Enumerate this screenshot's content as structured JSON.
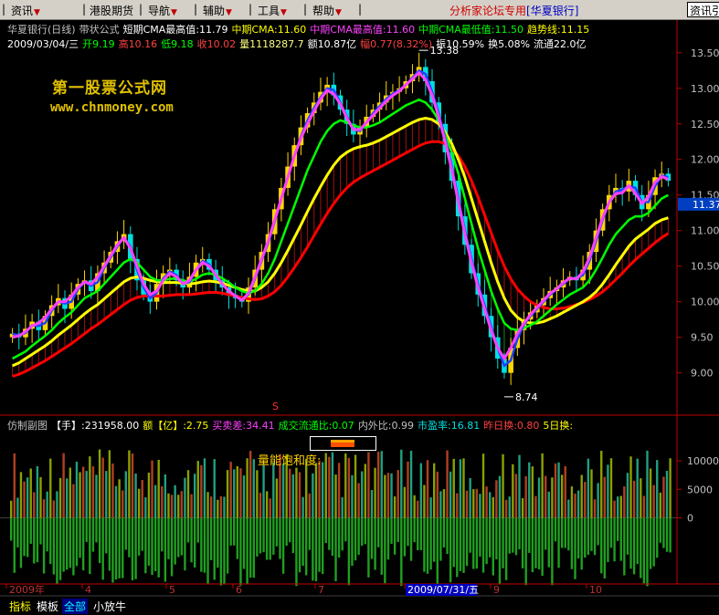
{
  "menu": {
    "items": [
      "资讯",
      "港股期货",
      "导航",
      "辅助",
      "工具",
      "帮助"
    ],
    "forum_text": "分析家论坛专用",
    "stock_tag": "[华夏银行]",
    "search_text": "资讯引"
  },
  "header": {
    "row1": [
      {
        "text": "华夏银行(日线)",
        "color": "#c0c0c0"
      },
      {
        "text": "带状公式",
        "color": "#c0c0c0"
      },
      {
        "text": "短期CMA最高值:11.79",
        "color": "#ffffff"
      },
      {
        "text": "中期CMA:11.60",
        "color": "#ffff00"
      },
      {
        "text": "中期CMA最高值:11.60",
        "color": "#ff40ff"
      },
      {
        "text": "中期CMA最低值:11.50",
        "color": "#00ff00"
      },
      {
        "text": "趋势线:11.15",
        "color": "#ffff00"
      }
    ],
    "row2": [
      {
        "text": "2009/03/04/三",
        "color": "#ffffff"
      },
      {
        "text": "开9.19",
        "color": "#00ff00"
      },
      {
        "text": "高10.16",
        "color": "#ff4040"
      },
      {
        "text": "低9.18",
        "color": "#00ff00"
      },
      {
        "text": "收10.02",
        "color": "#ff4040"
      },
      {
        "text": "量1118287.7",
        "color": "#ffff80"
      },
      {
        "text": "额10.87亿",
        "color": "#ffffff"
      },
      {
        "text": "幅0.77(8.32%)",
        "color": "#ff4040"
      },
      {
        "text": "振10.59%",
        "color": "#ffffff"
      },
      {
        "text": "换5.08%",
        "color": "#ffffff"
      },
      {
        "text": "流通22.0亿",
        "color": "#ffffff"
      }
    ],
    "watermark_cn": "第一股票公式网",
    "watermark_url": "www.chnmoney.com"
  },
  "colors": {
    "up_candle": "#ffd700",
    "down_candle": "#00e0e0",
    "axis_red": "#c00000",
    "short_cma": "#ff40ff",
    "fast_line": "#2040ff",
    "mid_cma": "#00ff00",
    "trend_yellow": "#ffff00",
    "trend_red": "#ff0000"
  },
  "chart_data": {
    "type": "candlestick",
    "title": "华夏银行(日线)",
    "ylim": [
      8.7,
      13.6
    ],
    "y_ticks": [
      "13.50",
      "13.00",
      "12.50",
      "12.00",
      "11.50",
      "11.00",
      "10.50",
      "10.00",
      "9.50",
      "9.00"
    ],
    "current_price": "11.37",
    "annotations": [
      {
        "text": "13.38",
        "value": 13.38,
        "kind": "high"
      },
      {
        "text": "8.74",
        "value": 8.74,
        "kind": "low"
      }
    ],
    "x_labels": [
      "2009年",
      "4",
      "5",
      "6",
      "7",
      "2009/07/31/五",
      "9",
      "10"
    ],
    "highlight_date": "2009/07/31/五",
    "close": [
      9.55,
      9.5,
      9.62,
      9.72,
      9.6,
      9.8,
      9.95,
      10.05,
      9.9,
      10.1,
      10.25,
      10.3,
      10.15,
      10.4,
      10.55,
      10.7,
      10.85,
      10.95,
      10.6,
      10.3,
      10.1,
      10.0,
      10.25,
      10.4,
      10.45,
      10.3,
      10.2,
      10.35,
      10.55,
      10.6,
      10.45,
      10.3,
      10.2,
      10.1,
      10.05,
      10.0,
      10.2,
      10.45,
      10.7,
      10.95,
      11.3,
      11.6,
      11.9,
      12.2,
      12.45,
      12.65,
      12.8,
      12.95,
      13.05,
      12.9,
      12.7,
      12.5,
      12.35,
      12.45,
      12.6,
      12.7,
      12.8,
      12.9,
      12.95,
      13.0,
      13.1,
      13.2,
      13.3,
      13.1,
      12.8,
      12.5,
      12.1,
      11.7,
      11.2,
      10.8,
      10.4,
      10.1,
      9.8,
      9.5,
      9.2,
      9.0,
      9.35,
      9.6,
      9.75,
      9.85,
      9.95,
      10.05,
      10.15,
      10.2,
      10.3,
      10.35,
      10.3,
      10.45,
      10.7,
      11.0,
      11.3,
      11.5,
      11.6,
      11.55,
      11.7,
      11.5,
      11.3,
      11.5,
      11.75,
      11.8,
      11.7
    ],
    "short_cma": [
      9.5,
      9.52,
      9.58,
      9.66,
      9.7,
      9.78,
      9.9,
      10.0,
      10.0,
      10.08,
      10.2,
      10.28,
      10.25,
      10.35,
      10.5,
      10.65,
      10.8,
      10.9,
      10.75,
      10.5,
      10.25,
      10.1,
      10.15,
      10.3,
      10.4,
      10.35,
      10.25,
      10.3,
      10.45,
      10.55,
      10.5,
      10.38,
      10.25,
      10.15,
      10.08,
      10.02,
      10.12,
      10.35,
      10.6,
      10.85,
      11.15,
      11.45,
      11.75,
      12.05,
      12.3,
      12.5,
      12.68,
      12.85,
      12.97,
      12.92,
      12.78,
      12.58,
      12.42,
      12.42,
      12.52,
      12.62,
      12.72,
      12.82,
      12.9,
      12.96,
      13.05,
      13.13,
      13.22,
      13.12,
      12.9,
      12.6,
      12.25,
      11.85,
      11.4,
      10.95,
      10.55,
      10.2,
      9.9,
      9.6,
      9.35,
      9.2,
      9.35,
      9.55,
      9.7,
      9.82,
      9.92,
      10.02,
      10.12,
      10.18,
      10.27,
      10.33,
      10.32,
      10.42,
      10.62,
      10.9,
      11.18,
      11.4,
      11.52,
      11.53,
      11.63,
      11.52,
      11.38,
      11.48,
      11.68,
      11.76,
      11.72
    ],
    "mid_cma": [
      9.2,
      9.25,
      9.3,
      9.38,
      9.45,
      9.52,
      9.6,
      9.7,
      9.78,
      9.85,
      9.95,
      10.05,
      10.1,
      10.15,
      10.25,
      10.35,
      10.45,
      10.55,
      10.6,
      10.55,
      10.45,
      10.35,
      10.3,
      10.3,
      10.32,
      10.33,
      10.3,
      10.28,
      10.32,
      10.38,
      10.4,
      10.38,
      10.33,
      10.27,
      10.2,
      10.15,
      10.12,
      10.15,
      10.25,
      10.4,
      10.6,
      10.85,
      11.1,
      11.35,
      11.6,
      11.85,
      12.05,
      12.25,
      12.4,
      12.5,
      12.55,
      12.52,
      12.48,
      12.45,
      12.45,
      12.48,
      12.52,
      12.58,
      12.64,
      12.7,
      12.76,
      12.8,
      12.84,
      12.8,
      12.7,
      12.55,
      12.35,
      12.1,
      11.8,
      11.45,
      11.1,
      10.75,
      10.45,
      10.15,
      9.9,
      9.7,
      9.62,
      9.6,
      9.63,
      9.67,
      9.72,
      9.8,
      9.88,
      9.96,
      10.03,
      10.1,
      10.15,
      10.2,
      10.3,
      10.45,
      10.62,
      10.8,
      10.95,
      11.05,
      11.15,
      11.2,
      11.2,
      11.25,
      11.35,
      11.45,
      11.5
    ],
    "trend_yellow": [
      9.1,
      9.14,
      9.2,
      9.26,
      9.32,
      9.38,
      9.45,
      9.53,
      9.6,
      9.67,
      9.75,
      9.83,
      9.9,
      9.96,
      10.04,
      10.12,
      10.2,
      10.28,
      10.33,
      10.35,
      10.33,
      10.3,
      10.28,
      10.27,
      10.27,
      10.27,
      10.26,
      10.25,
      10.26,
      10.28,
      10.29,
      10.28,
      10.26,
      10.23,
      10.2,
      10.17,
      10.15,
      10.15,
      10.2,
      10.28,
      10.4,
      10.55,
      10.72,
      10.9,
      11.08,
      11.27,
      11.45,
      11.62,
      11.78,
      11.92,
      12.03,
      12.1,
      12.15,
      12.18,
      12.2,
      12.23,
      12.27,
      12.32,
      12.37,
      12.42,
      12.47,
      12.52,
      12.56,
      12.58,
      12.56,
      12.5,
      12.38,
      12.22,
      12.0,
      11.75,
      11.45,
      11.15,
      10.85,
      10.55,
      10.28,
      10.05,
      9.88,
      9.78,
      9.72,
      9.7,
      9.7,
      9.72,
      9.76,
      9.8,
      9.85,
      9.9,
      9.95,
      10.0,
      10.06,
      10.14,
      10.25,
      10.38,
      10.52,
      10.65,
      10.78,
      10.88,
      10.95,
      11.02,
      11.1,
      11.15,
      11.18
    ],
    "trend_red": [
      8.95,
      8.98,
      9.02,
      9.07,
      9.12,
      9.17,
      9.23,
      9.29,
      9.35,
      9.41,
      9.48,
      9.55,
      9.62,
      9.68,
      9.75,
      9.82,
      9.89,
      9.96,
      10.02,
      10.06,
      10.08,
      10.08,
      10.08,
      10.08,
      10.09,
      10.1,
      10.1,
      10.1,
      10.11,
      10.12,
      10.13,
      10.13,
      10.12,
      10.1,
      10.08,
      10.06,
      10.04,
      10.03,
      10.04,
      10.08,
      10.14,
      10.23,
      10.35,
      10.48,
      10.62,
      10.77,
      10.93,
      11.09,
      11.24,
      11.38,
      11.5,
      11.6,
      11.68,
      11.74,
      11.79,
      11.84,
      11.89,
      11.94,
      11.99,
      12.04,
      12.09,
      12.14,
      12.19,
      12.23,
      12.25,
      12.25,
      12.22,
      12.15,
      12.05,
      11.9,
      11.7,
      11.47,
      11.22,
      10.97,
      10.72,
      10.5,
      10.32,
      10.18,
      10.08,
      10.0,
      9.95,
      9.92,
      9.9,
      9.9,
      9.91,
      9.93,
      9.96,
      9.99,
      10.03,
      10.08,
      10.14,
      10.22,
      10.31,
      10.4,
      10.5,
      10.59,
      10.67,
      10.75,
      10.83,
      10.9,
      10.96
    ]
  },
  "volume_panel": {
    "items": [
      {
        "text": "仿制副图",
        "color": "#c0c0c0"
      },
      {
        "text": "【手】:231958.00",
        "color": "#ffffff"
      },
      {
        "text": "额【亿】:2.75",
        "color": "#ffff00"
      },
      {
        "text": "买卖差:34.41",
        "color": "#ff40ff"
      },
      {
        "text": "成交流通比:0.07",
        "color": "#00ff00"
      },
      {
        "text": "内外比:0.99",
        "color": "#c0c0c0"
      },
      {
        "text": "市盈率:16.81",
        "color": "#00e0e0"
      },
      {
        "text": "昨日换:0.80",
        "color": "#ff4040"
      },
      {
        "text": "5日换:",
        "color": "#ffff00"
      }
    ],
    "saturation_label": "量能饱和度:",
    "ylim": [
      -10000,
      14000
    ],
    "y_ticks": [
      "10000",
      "5000",
      "0"
    ],
    "marker": "S"
  },
  "tabs": [
    {
      "text": "指标",
      "color": "#ffff00",
      "bg": "#000000"
    },
    {
      "text": "模板",
      "color": "#ffffff",
      "bg": "#000000"
    },
    {
      "text": "全部",
      "color": "#00ffff",
      "bg": "#000080"
    },
    {
      "text": "小放牛",
      "color": "#ffffff",
      "bg": "#000000"
    }
  ]
}
